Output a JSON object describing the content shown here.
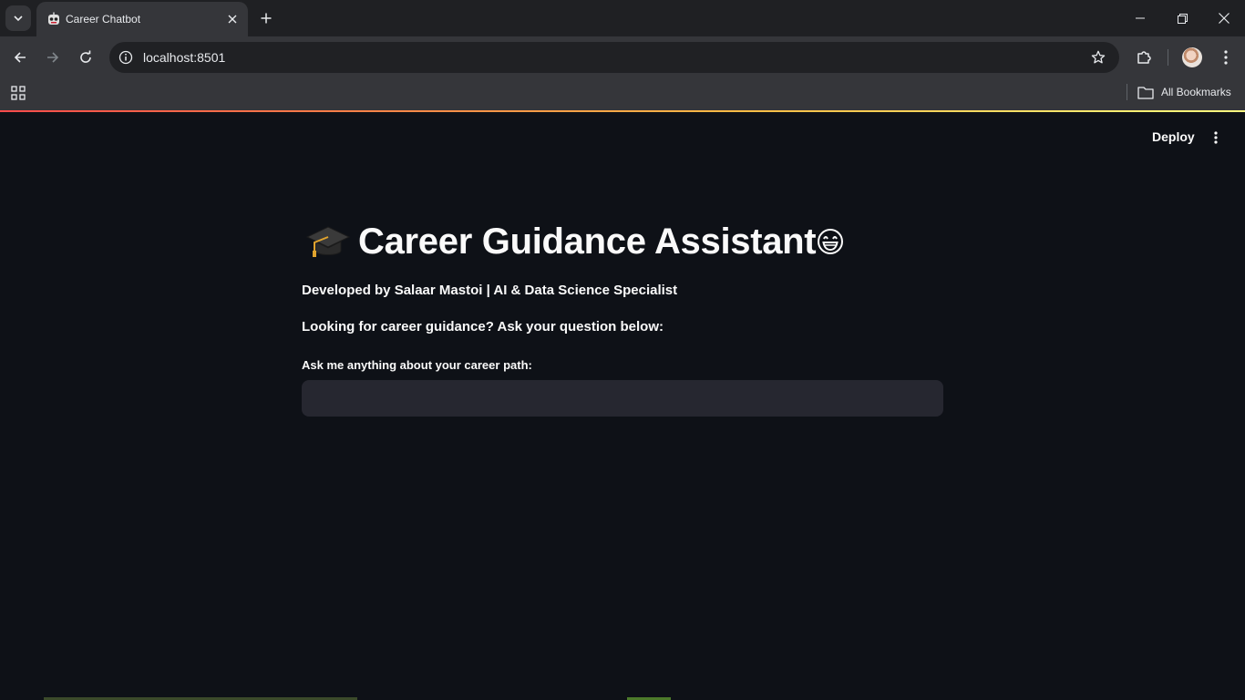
{
  "browser": {
    "tab_title": "Career Chatbot",
    "url": "localhost:8501",
    "bookmarks_label": "All Bookmarks"
  },
  "app": {
    "deploy_label": "Deploy",
    "title": "Career Guidance Assistant",
    "title_prefix_icon": "graduation-cap-icon",
    "title_suffix_icon": "grinning-face-icon",
    "subtitle": "Developed by Salaar Mastoi | AI & Data Science Specialist",
    "prompt": "Looking for career guidance? Ask your question below:",
    "input_label": "Ask me anything about your career path:",
    "input_value": ""
  },
  "colors": {
    "app_background": "#0e1117",
    "input_background": "#262730",
    "browser_toolbar": "#35363a",
    "accent_start": "#ff4b4b",
    "accent_end": "#fffd80"
  }
}
